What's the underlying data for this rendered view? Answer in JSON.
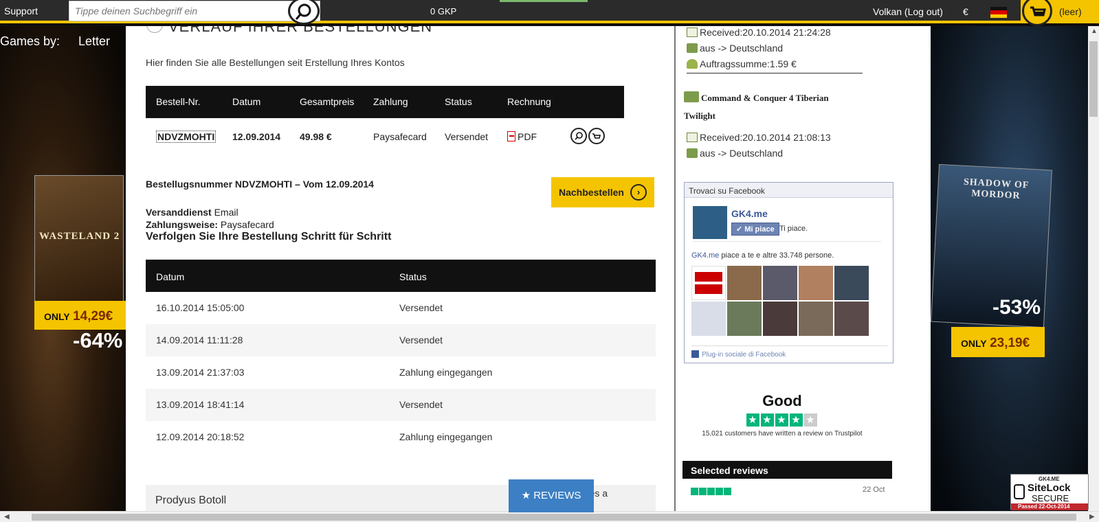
{
  "topbar": {
    "support": "Support",
    "search_placeholder": "Tippe deinen Suchbegriff ein",
    "gkp": "0 GKP",
    "user": "Volkan (Log out)",
    "currency": "€",
    "cart": "(leer)"
  },
  "nav": {
    "games_by": "Games by:",
    "letter": "Letter"
  },
  "left_ad": {
    "box_title": "WASTELAND 2",
    "price_label": "ONLY",
    "price": "14,29€",
    "discount": "-64%"
  },
  "right_ad": {
    "box_title": "SHADOW OF MORDOR",
    "discount": "-53%",
    "price_label": "ONLY",
    "price": "23,19€"
  },
  "main": {
    "title": "VERLAUF IHRER BESTELLUNGEN",
    "intro": "Hier finden Sie alle Bestellungen seit Erstellung Ihres Kontos",
    "orders_headers": [
      "Bestell-Nr.",
      "Datum",
      "Gesamtpreis",
      "Zahlung",
      "Status",
      "Rechnung"
    ],
    "orders": [
      {
        "id": "NDVZMOHTI",
        "date": "12.09.2014",
        "total": "49.98 €",
        "payment": "Paysafecard",
        "status": "Versendet",
        "invoice": "PDF"
      }
    ],
    "detail_heading": "Bestellugsnummer NDVZMOHTI – Vom 12.09.2014",
    "reorder_label": "Nachbestellen",
    "shipping_label": "Versanddienst",
    "shipping_value": "Email",
    "payment_label": "Zahlungsweise:",
    "payment_value": "Paysafecard",
    "track_heading": "Verfolgen Sie Ihre Bestellung Schritt für Schritt",
    "history_headers": [
      "Datum",
      "Status"
    ],
    "history": [
      {
        "date": "16.10.2014 15:05:00",
        "status": "Versendet"
      },
      {
        "date": "14.09.2014 11:11:28",
        "status": "Versendet"
      },
      {
        "date": "13.09.2014 21:37:03",
        "status": "Zahlung eingegangen"
      },
      {
        "date": "13.09.2014 18:41:14",
        "status": "Versendet"
      },
      {
        "date": "12.09.2014 20:18:52",
        "status": "Zahlung eingegangen"
      }
    ],
    "next_section": "Prodyus Botoll",
    "next_tail": "udes a",
    "reviews_button": "★ REVIEWS"
  },
  "sidebar": {
    "first": {
      "received": "Received:20.10.2014 21:24:28",
      "route": "aus -> Deutschland",
      "sum": "Auftragssumme:1.59 €"
    },
    "second": {
      "title": "Command & Conquer 4 Tiberian Twilight",
      "received": "Received:20.10.2014 21:08:13",
      "route": "aus -> Deutschland"
    },
    "facebook": {
      "header": "Trovaci su Facebook",
      "page_name": "GK4.me",
      "like_button": "Mi piace",
      "like_status": "Ti piace.",
      "count_link": "GK4.me",
      "count_text": "piace a te e altre 33.748 persone.",
      "footer": "Plug-in sociale di Facebook"
    },
    "trustpilot": {
      "rating_word": "Good",
      "stars": 4,
      "count_text": "15,021 customers have written a review on Trustpilot",
      "selected_reviews": "Selected reviews",
      "review_date": "22 Oct"
    },
    "sitelock": {
      "site": "GK4.ME",
      "brand": "SiteLock",
      "secure": "SECURE",
      "passed": "Passed   22-Oct-2014"
    }
  }
}
